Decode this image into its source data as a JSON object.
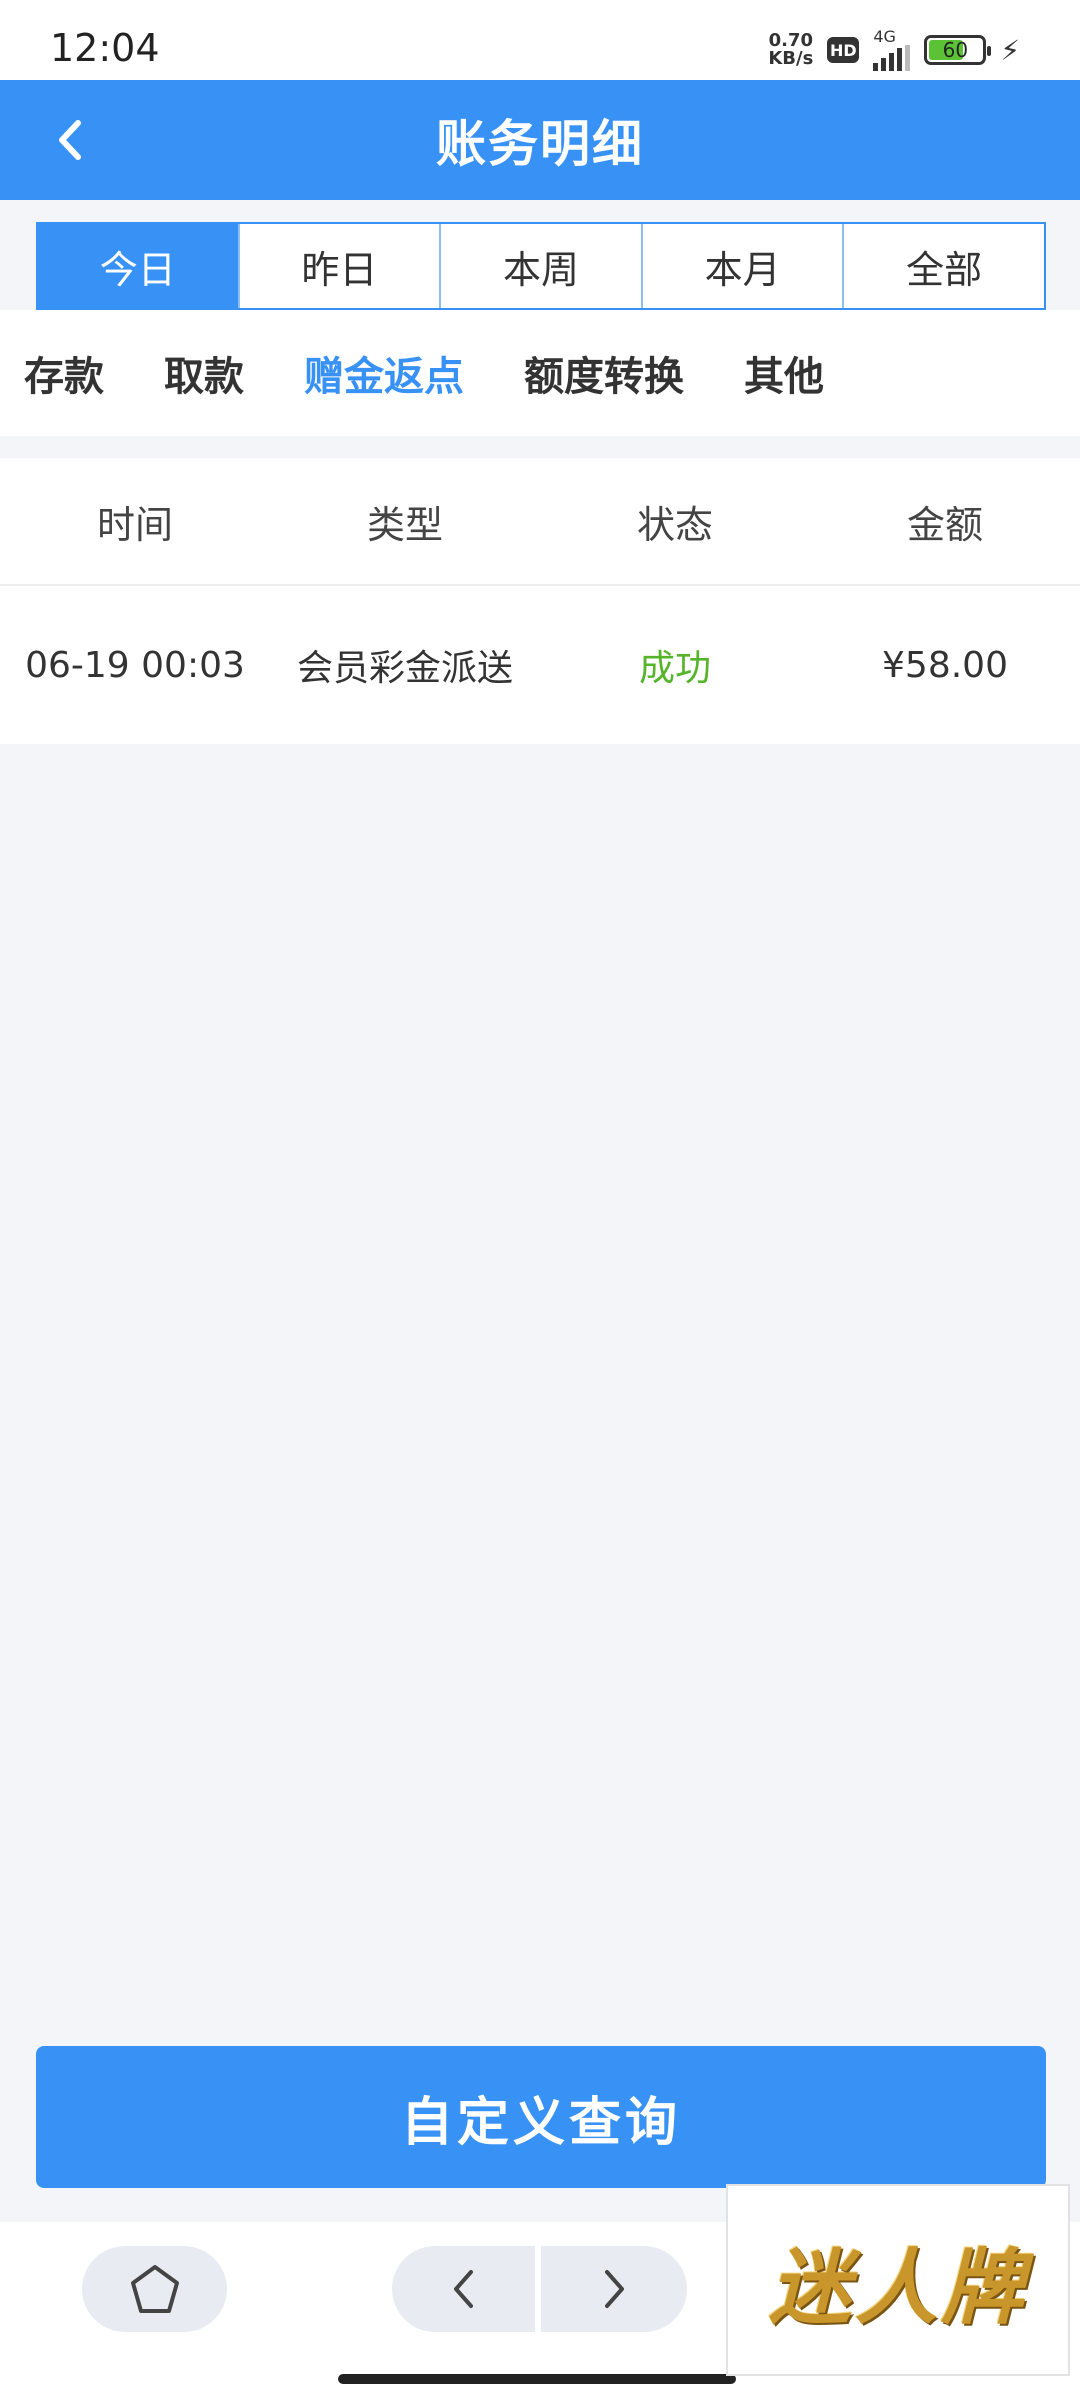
{
  "status_bar": {
    "time": "12:04",
    "net_speed_value": "0.70",
    "net_speed_unit": "KB/s",
    "hd_badge": "HD",
    "signal_label": "4G",
    "battery_level": "60",
    "icons": [
      "hd-icon",
      "signal-icon",
      "battery-icon",
      "charging-icon"
    ]
  },
  "header": {
    "title": "账务明细",
    "back_icon": "chevron-left-icon"
  },
  "date_tabs": [
    {
      "label": "今日",
      "active": true
    },
    {
      "label": "昨日",
      "active": false
    },
    {
      "label": "本周",
      "active": false
    },
    {
      "label": "本月",
      "active": false
    },
    {
      "label": "全部",
      "active": false
    }
  ],
  "category_tabs": [
    {
      "label": "存款",
      "active": false
    },
    {
      "label": "取款",
      "active": false
    },
    {
      "label": "赠金返点",
      "active": true
    },
    {
      "label": "额度转换",
      "active": false
    },
    {
      "label": "其他",
      "active": false
    }
  ],
  "table": {
    "columns": [
      "时间",
      "类型",
      "状态",
      "金额"
    ],
    "rows": [
      {
        "time": "06-19 00:03",
        "type": "会员彩金派送",
        "status": "成功",
        "amount": "¥58.00"
      }
    ]
  },
  "query_button": {
    "label": "自定义查询"
  },
  "bottom_nav": {
    "icons": [
      "home-icon",
      "chevron-left-icon",
      "chevron-right-icon"
    ]
  },
  "watermark": {
    "text": "迷人牌"
  },
  "colors": {
    "primary": "#3892f6",
    "success": "#56b42a",
    "background": "#f3f5f8"
  }
}
